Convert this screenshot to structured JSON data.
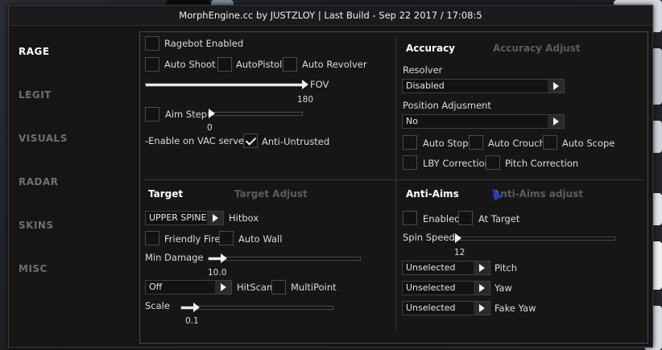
{
  "window": {
    "title": "MorphEngine.cc by JUSTZLOY | Last Build - Sep 22 2017 / 17:08:5"
  },
  "sidebar": {
    "items": [
      {
        "label": "RAGE",
        "active": true
      },
      {
        "label": "LEGIT"
      },
      {
        "label": "VISUALS"
      },
      {
        "label": "RADAR"
      },
      {
        "label": "SKINS"
      },
      {
        "label": "MISC"
      }
    ]
  },
  "rage": {
    "ragebot_enabled": {
      "label": "Ragebot Enabled",
      "checked": false
    },
    "auto_shoot": {
      "label": "Auto Shoot",
      "checked": false
    },
    "auto_pistol": {
      "label": "AutoPistol",
      "checked": false
    },
    "auto_revolver": {
      "label": "Auto Revolver",
      "checked": false
    },
    "fov": {
      "label": "FOV",
      "value": "180",
      "fraction": 1.0
    },
    "aim_step": {
      "label": "Aim Step",
      "value": "0",
      "fraction": 0.0
    },
    "vac_note": "-Enable on VAC servers",
    "anti_untrusted": {
      "label": "Anti-Untrusted",
      "checked": true
    }
  },
  "accuracy": {
    "tab_active": "Accuracy",
    "tab_inactive": "Accuracy Adjust",
    "resolver": {
      "label": "Resolver",
      "value": "Disabled"
    },
    "position_adjustment": {
      "label": "Position Adjusment",
      "value": "No"
    },
    "auto_stop": {
      "label": "Auto Stop",
      "checked": false
    },
    "auto_crouch": {
      "label": "Auto Crouch",
      "checked": false
    },
    "auto_scope": {
      "label": "Auto Scope",
      "checked": false
    },
    "lby_correction": {
      "label": "LBY Correction",
      "checked": false
    },
    "pitch_correction": {
      "label": "Pitch Correction",
      "checked": false
    }
  },
  "target": {
    "tab_active": "Target",
    "tab_inactive": "Target Adjust",
    "hitbox": {
      "label": "Hitbox",
      "value": "UPPER SPINE"
    },
    "friendly_fire": {
      "label": "Friendly Fire",
      "checked": false
    },
    "auto_wall": {
      "label": "Auto Wall",
      "checked": false
    },
    "min_damage": {
      "label": "Min Damage",
      "value": "10.0",
      "fraction": 0.1
    },
    "hitscan": {
      "label": "HitScan",
      "value": "Off"
    },
    "multipoint": {
      "label": "MultiPoint",
      "checked": false
    },
    "scale": {
      "label": "Scale",
      "value": "0.1",
      "fraction": 0.1
    }
  },
  "anti_aims": {
    "tab_active": "Anti-Aims",
    "tab_inactive": "Anti-Aims adjust",
    "enabled": {
      "label": "Enabled",
      "checked": false
    },
    "at_target": {
      "label": "At Target",
      "checked": false
    },
    "spin_speed": {
      "label": "Spin Speed",
      "value": "12",
      "fraction": 0.0
    },
    "pitch": {
      "label": "Pitch",
      "value": "Unselected"
    },
    "yaw": {
      "label": "Yaw",
      "value": "Unselected"
    },
    "fake_yaw": {
      "label": "Fake Yaw",
      "value": "Unselected"
    }
  },
  "icons": {
    "cursor": "mouse-cursor-icon"
  }
}
